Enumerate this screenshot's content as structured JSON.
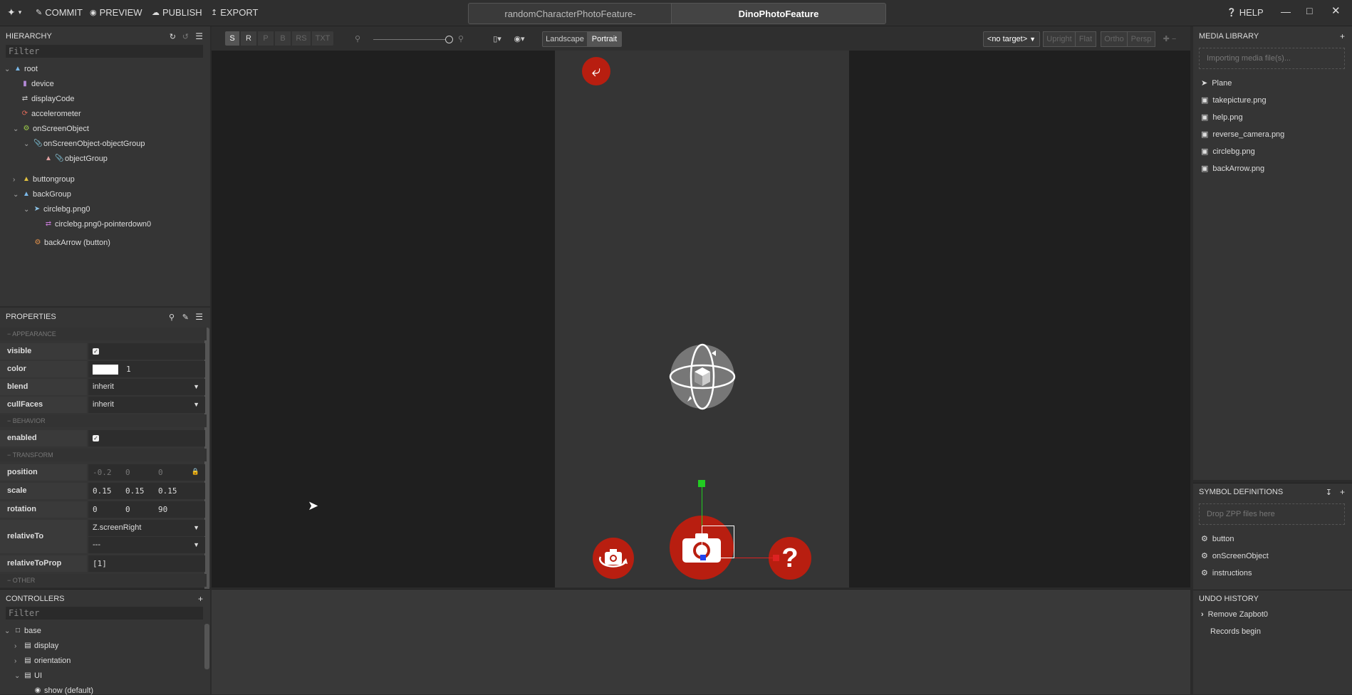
{
  "topbar": {
    "commit": "COMMIT",
    "preview": "PREVIEW",
    "publish": "PUBLISH",
    "export": "EXPORT",
    "tab1": "randomCharacterPhotoFeature-",
    "tab2": "DinoPhotoFeature",
    "help": "HELP"
  },
  "hierarchy": {
    "title": "HIERARCHY",
    "filter_placeholder": "Filter",
    "items": [
      {
        "label": "root"
      },
      {
        "label": "device"
      },
      {
        "label": "displayCode"
      },
      {
        "label": "accelerometer"
      },
      {
        "label": "onScreenObject"
      },
      {
        "label": "onScreenObject-objectGroup"
      },
      {
        "label": "objectGroup"
      },
      {
        "label": "buttongroup"
      },
      {
        "label": "backGroup"
      },
      {
        "label": "circlebg.png0"
      },
      {
        "label": "circlebg.png0-pointerdown0"
      },
      {
        "label": "backArrow (button)"
      }
    ]
  },
  "properties": {
    "title": "PROPERTIES",
    "sections": {
      "appearance": "APPEARANCE",
      "behavior": "BEHAVIOR",
      "transform": "TRANSFORM",
      "other": "OTHER"
    },
    "visible": "visible",
    "color": "color",
    "color_alpha": "1",
    "blend": "blend",
    "blend_value": "inherit",
    "cullFaces": "cullFaces",
    "cullFaces_value": "inherit",
    "enabled": "enabled",
    "position": "position",
    "position_values": [
      "-0.2",
      "0",
      "0"
    ],
    "scale": "scale",
    "scale_values": [
      "0.15",
      "0.15",
      "0.15"
    ],
    "rotation": "rotation",
    "rotation_values": [
      "0",
      "0",
      "90"
    ],
    "relativeTo": "relativeTo",
    "relativeTo_value1": "Z.screenRight",
    "relativeTo_value2": "---",
    "relativeToProp": "relativeToProp",
    "relativeToProp_value": "[1]"
  },
  "controllers": {
    "title": "CONTROLLERS",
    "filter_placeholder": "Filter",
    "items": [
      {
        "label": "base"
      },
      {
        "label": "display"
      },
      {
        "label": "orientation"
      },
      {
        "label": "UI"
      },
      {
        "label": "show (default)"
      }
    ]
  },
  "viewport_toolbar": {
    "s": "S",
    "r": "R",
    "p": "P",
    "b": "B",
    "rs": "RS",
    "txt": "TXT",
    "landscape": "Landscape",
    "portrait": "Portrait",
    "target": "<no target>",
    "upright": "Upright",
    "flat": "Flat",
    "ortho": "Ortho",
    "persp": "Persp"
  },
  "media_library": {
    "title": "MEDIA LIBRARY",
    "importing": "Importing media file(s)...",
    "items": [
      {
        "label": "Plane"
      },
      {
        "label": "takepicture.png"
      },
      {
        "label": "help.png"
      },
      {
        "label": "reverse_camera.png"
      },
      {
        "label": "circlebg.png"
      },
      {
        "label": "backArrow.png"
      }
    ]
  },
  "symbol_definitions": {
    "title": "SYMBOL DEFINITIONS",
    "drop": "Drop ZPP files here",
    "items": [
      {
        "label": "button"
      },
      {
        "label": "onScreenObject"
      },
      {
        "label": "instructions"
      }
    ]
  },
  "undo_history": {
    "title": "UNDO HISTORY",
    "items": [
      {
        "label": "Remove Zapbot0"
      },
      {
        "label": "Records begin"
      }
    ]
  },
  "colors": {
    "accent_red": "#b81e10",
    "gizmo_green": "#22cc22",
    "gizmo_red": "#dd2222"
  }
}
